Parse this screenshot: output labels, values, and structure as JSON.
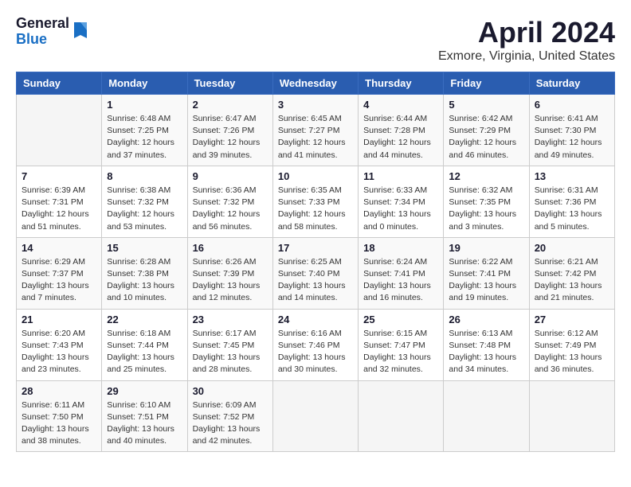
{
  "app": {
    "logo_general": "General",
    "logo_blue": "Blue",
    "month": "April 2024",
    "location": "Exmore, Virginia, United States"
  },
  "calendar": {
    "headers": [
      "Sunday",
      "Monday",
      "Tuesday",
      "Wednesday",
      "Thursday",
      "Friday",
      "Saturday"
    ],
    "weeks": [
      [
        {
          "day": "",
          "info": ""
        },
        {
          "day": "1",
          "info": "Sunrise: 6:48 AM\nSunset: 7:25 PM\nDaylight: 12 hours\nand 37 minutes."
        },
        {
          "day": "2",
          "info": "Sunrise: 6:47 AM\nSunset: 7:26 PM\nDaylight: 12 hours\nand 39 minutes."
        },
        {
          "day": "3",
          "info": "Sunrise: 6:45 AM\nSunset: 7:27 PM\nDaylight: 12 hours\nand 41 minutes."
        },
        {
          "day": "4",
          "info": "Sunrise: 6:44 AM\nSunset: 7:28 PM\nDaylight: 12 hours\nand 44 minutes."
        },
        {
          "day": "5",
          "info": "Sunrise: 6:42 AM\nSunset: 7:29 PM\nDaylight: 12 hours\nand 46 minutes."
        },
        {
          "day": "6",
          "info": "Sunrise: 6:41 AM\nSunset: 7:30 PM\nDaylight: 12 hours\nand 49 minutes."
        }
      ],
      [
        {
          "day": "7",
          "info": "Sunrise: 6:39 AM\nSunset: 7:31 PM\nDaylight: 12 hours\nand 51 minutes."
        },
        {
          "day": "8",
          "info": "Sunrise: 6:38 AM\nSunset: 7:32 PM\nDaylight: 12 hours\nand 53 minutes."
        },
        {
          "day": "9",
          "info": "Sunrise: 6:36 AM\nSunset: 7:32 PM\nDaylight: 12 hours\nand 56 minutes."
        },
        {
          "day": "10",
          "info": "Sunrise: 6:35 AM\nSunset: 7:33 PM\nDaylight: 12 hours\nand 58 minutes."
        },
        {
          "day": "11",
          "info": "Sunrise: 6:33 AM\nSunset: 7:34 PM\nDaylight: 13 hours\nand 0 minutes."
        },
        {
          "day": "12",
          "info": "Sunrise: 6:32 AM\nSunset: 7:35 PM\nDaylight: 13 hours\nand 3 minutes."
        },
        {
          "day": "13",
          "info": "Sunrise: 6:31 AM\nSunset: 7:36 PM\nDaylight: 13 hours\nand 5 minutes."
        }
      ],
      [
        {
          "day": "14",
          "info": "Sunrise: 6:29 AM\nSunset: 7:37 PM\nDaylight: 13 hours\nand 7 minutes."
        },
        {
          "day": "15",
          "info": "Sunrise: 6:28 AM\nSunset: 7:38 PM\nDaylight: 13 hours\nand 10 minutes."
        },
        {
          "day": "16",
          "info": "Sunrise: 6:26 AM\nSunset: 7:39 PM\nDaylight: 13 hours\nand 12 minutes."
        },
        {
          "day": "17",
          "info": "Sunrise: 6:25 AM\nSunset: 7:40 PM\nDaylight: 13 hours\nand 14 minutes."
        },
        {
          "day": "18",
          "info": "Sunrise: 6:24 AM\nSunset: 7:41 PM\nDaylight: 13 hours\nand 16 minutes."
        },
        {
          "day": "19",
          "info": "Sunrise: 6:22 AM\nSunset: 7:41 PM\nDaylight: 13 hours\nand 19 minutes."
        },
        {
          "day": "20",
          "info": "Sunrise: 6:21 AM\nSunset: 7:42 PM\nDaylight: 13 hours\nand 21 minutes."
        }
      ],
      [
        {
          "day": "21",
          "info": "Sunrise: 6:20 AM\nSunset: 7:43 PM\nDaylight: 13 hours\nand 23 minutes."
        },
        {
          "day": "22",
          "info": "Sunrise: 6:18 AM\nSunset: 7:44 PM\nDaylight: 13 hours\nand 25 minutes."
        },
        {
          "day": "23",
          "info": "Sunrise: 6:17 AM\nSunset: 7:45 PM\nDaylight: 13 hours\nand 28 minutes."
        },
        {
          "day": "24",
          "info": "Sunrise: 6:16 AM\nSunset: 7:46 PM\nDaylight: 13 hours\nand 30 minutes."
        },
        {
          "day": "25",
          "info": "Sunrise: 6:15 AM\nSunset: 7:47 PM\nDaylight: 13 hours\nand 32 minutes."
        },
        {
          "day": "26",
          "info": "Sunrise: 6:13 AM\nSunset: 7:48 PM\nDaylight: 13 hours\nand 34 minutes."
        },
        {
          "day": "27",
          "info": "Sunrise: 6:12 AM\nSunset: 7:49 PM\nDaylight: 13 hours\nand 36 minutes."
        }
      ],
      [
        {
          "day": "28",
          "info": "Sunrise: 6:11 AM\nSunset: 7:50 PM\nDaylight: 13 hours\nand 38 minutes."
        },
        {
          "day": "29",
          "info": "Sunrise: 6:10 AM\nSunset: 7:51 PM\nDaylight: 13 hours\nand 40 minutes."
        },
        {
          "day": "30",
          "info": "Sunrise: 6:09 AM\nSunset: 7:52 PM\nDaylight: 13 hours\nand 42 minutes."
        },
        {
          "day": "",
          "info": ""
        },
        {
          "day": "",
          "info": ""
        },
        {
          "day": "",
          "info": ""
        },
        {
          "day": "",
          "info": ""
        }
      ]
    ]
  }
}
